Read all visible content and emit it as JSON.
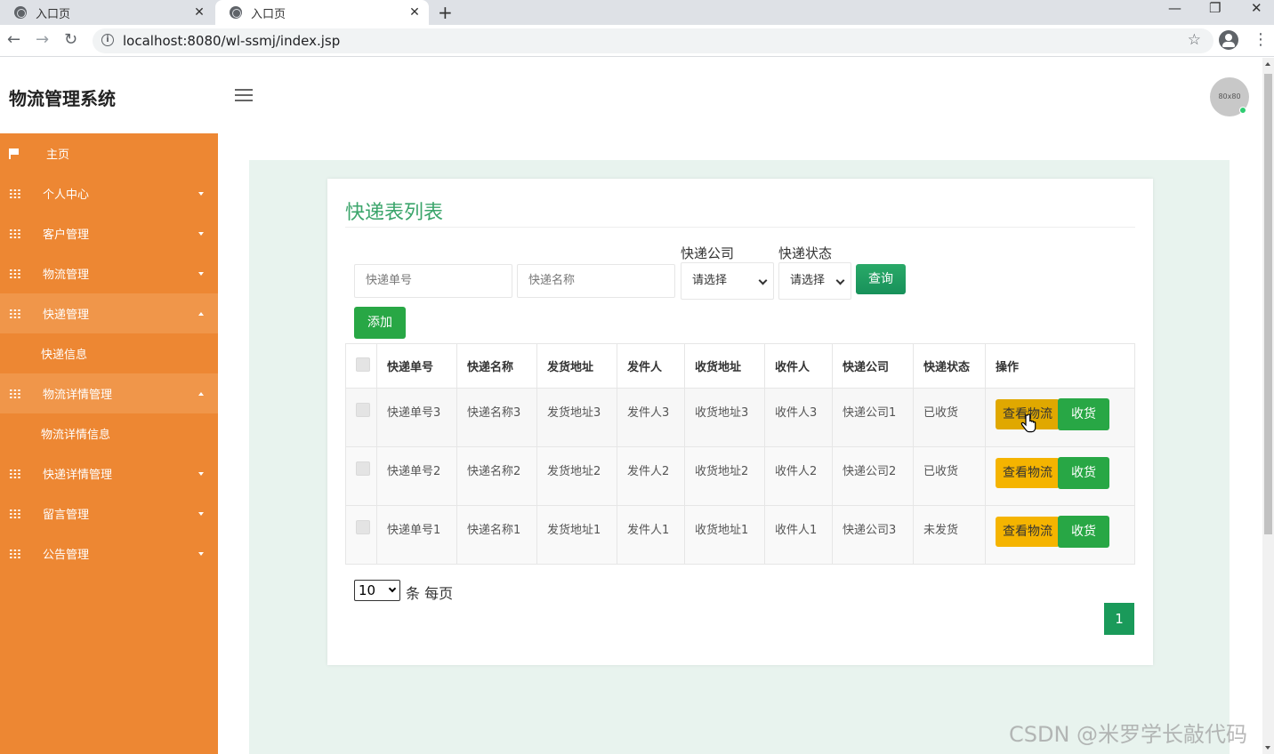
{
  "browser": {
    "tabs": [
      {
        "title": "入口页",
        "close": "✕"
      },
      {
        "title": "入口页",
        "close": "✕"
      }
    ],
    "new_tab": "+",
    "window_controls": {
      "minimize": "—",
      "restore": "❐",
      "close": "✕"
    },
    "nav": {
      "back": "←",
      "forward": "→",
      "reload": "↻"
    },
    "url": "localhost:8080/wl-ssmj/index.jsp",
    "star": "☆",
    "menu": "⋮"
  },
  "app": {
    "title": "物流管理系统",
    "avatar_text": "80x80"
  },
  "sidebar": {
    "items": [
      {
        "label": "主页",
        "icon": "flag-icon",
        "caret": "none"
      },
      {
        "label": "个人中心",
        "icon": "grid-icon",
        "caret": "down"
      },
      {
        "label": "客户管理",
        "icon": "grid-icon",
        "caret": "down"
      },
      {
        "label": "物流管理",
        "icon": "grid-icon",
        "caret": "down"
      },
      {
        "label": "快递管理",
        "icon": "grid-icon",
        "caret": "up"
      },
      {
        "label": "快递信息",
        "type": "submenu"
      },
      {
        "label": "物流详情管理",
        "icon": "grid-icon",
        "caret": "up"
      },
      {
        "label": "物流详情信息",
        "type": "submenu"
      },
      {
        "label": "快递详情管理",
        "icon": "grid-icon",
        "caret": "down"
      },
      {
        "label": "留言管理",
        "icon": "grid-icon",
        "caret": "down"
      },
      {
        "label": "公告管理",
        "icon": "grid-icon",
        "caret": "down"
      }
    ]
  },
  "main": {
    "title": "快递表列表",
    "filters": {
      "tracking_no_placeholder": "快递单号",
      "name_placeholder": "快递名称",
      "company_label": "快递公司",
      "company_value": "请选择",
      "status_label": "快递状态",
      "status_value": "请选择",
      "search_button": "查询"
    },
    "add_button": "添加",
    "table": {
      "headers": [
        "快递单号",
        "快递名称",
        "发货地址",
        "发件人",
        "收货地址",
        "收件人",
        "快递公司",
        "快递状态",
        "操作"
      ],
      "rows": [
        {
          "no": "快递单号3",
          "name": "快递名称3",
          "from": "发货地址3",
          "sender": "发件人3",
          "to": "收货地址3",
          "receiver": "收件人3",
          "company": "快递公司1",
          "status": "已收货"
        },
        {
          "no": "快递单号2",
          "name": "快递名称2",
          "from": "发货地址2",
          "sender": "发件人2",
          "to": "收货地址2",
          "receiver": "收件人2",
          "company": "快递公司2",
          "status": "已收货"
        },
        {
          "no": "快递单号1",
          "name": "快递名称1",
          "from": "发货地址1",
          "sender": "发件人1",
          "to": "收货地址1",
          "receiver": "收件人1",
          "company": "快递公司3",
          "status": "未发货"
        }
      ],
      "view_button": "查看物流",
      "receive_button": "收货"
    },
    "pagination": {
      "page_size": "10",
      "per_page_label": "条 每页",
      "current_page": "1"
    }
  },
  "watermark": "CSDN @米罗学长敲代码",
  "colors": {
    "sidebar": "#ed8733",
    "accent_green": "#28a745",
    "title_green": "#3ba56b",
    "view_button": "#f5b400",
    "content_bg": "#e8f3ee"
  }
}
